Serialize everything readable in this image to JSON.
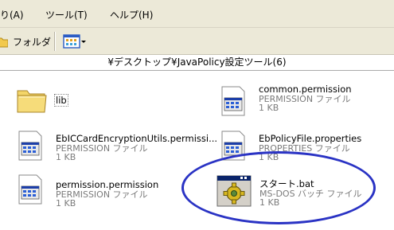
{
  "menubar": {
    "items": [
      {
        "label": "り(A)"
      },
      {
        "label": "ツール(T)"
      },
      {
        "label": "ヘルプ(H)"
      }
    ]
  },
  "toolbar": {
    "folders_label": "フォルダ"
  },
  "address": {
    "path": "¥デスクトップ¥JavaPolicy設定ツール(6)"
  },
  "files": [
    {
      "name": "lib",
      "type": "",
      "size": "",
      "icon": "folder-icon"
    },
    {
      "name": "common.permission",
      "type": "PERMISSION ファイル",
      "size": "1 KB",
      "icon": "document-icon"
    },
    {
      "name": "EbICCardEncryptionUtils.permissi...",
      "type": "PERMISSION ファイル",
      "size": "1 KB",
      "icon": "document-icon"
    },
    {
      "name": "EbPolicyFile.properties",
      "type": "PROPERTIES ファイル",
      "size": "1 KB",
      "icon": "document-icon"
    },
    {
      "name": "permission.permission",
      "type": "PERMISSION ファイル",
      "size": "1 KB",
      "icon": "document-icon"
    },
    {
      "name": "スタート.bat",
      "type": "MS-DOS バッチ ファイル",
      "size": "1 KB",
      "icon": "batch-file-icon"
    }
  ],
  "annotation": {
    "color": "#2a33c4"
  }
}
